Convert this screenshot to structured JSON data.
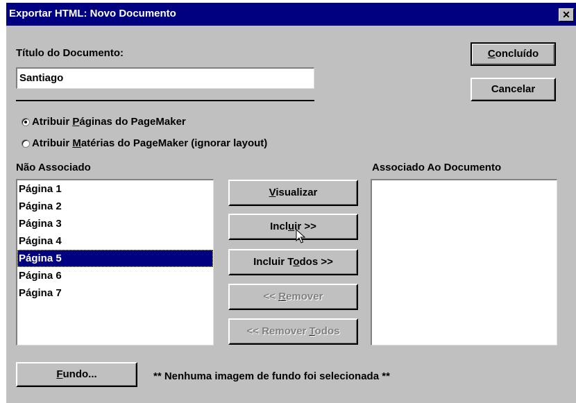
{
  "window": {
    "title": "Exportar HTML: Novo Documento",
    "close_symbol": "✕"
  },
  "title_field": {
    "label": "Título do Documento:",
    "value": "Santiago"
  },
  "buttons": {
    "done": {
      "pre": "",
      "key": "C",
      "post": "oncluído"
    },
    "cancel": {
      "label": "Cancelar"
    },
    "preview": {
      "pre": "",
      "key": "V",
      "post": "isualizar"
    },
    "include": {
      "pre": "Incl",
      "key": "u",
      "post": "ir >>"
    },
    "include_all": {
      "pre": "Incluir T",
      "key": "o",
      "post": "dos >>"
    },
    "remove": {
      "pre": "<< ",
      "key": "R",
      "post": "emover"
    },
    "remove_all": {
      "pre": "<< Remover ",
      "key": "T",
      "post": "odos"
    },
    "background": {
      "pre": "",
      "key": "F",
      "post": "undo..."
    }
  },
  "options": [
    {
      "pre": "Atribuir ",
      "key": "P",
      "post": "áginas do PageMaker",
      "checked": true
    },
    {
      "pre": "Atribuir ",
      "key": "M",
      "post": "atérias do PageMaker (ignorar layout)",
      "checked": false
    }
  ],
  "unassigned": {
    "label": "Não Associado",
    "items": [
      "Página 1",
      "Página 2",
      "Página 3",
      "Página 4",
      "Página 5",
      "Página 6",
      "Página 7"
    ],
    "selected_index": 4
  },
  "assigned": {
    "label": "Associado Ao Documento",
    "items": []
  },
  "status": {
    "text": "** Nenhuma imagem de fundo foi selecionada **"
  }
}
